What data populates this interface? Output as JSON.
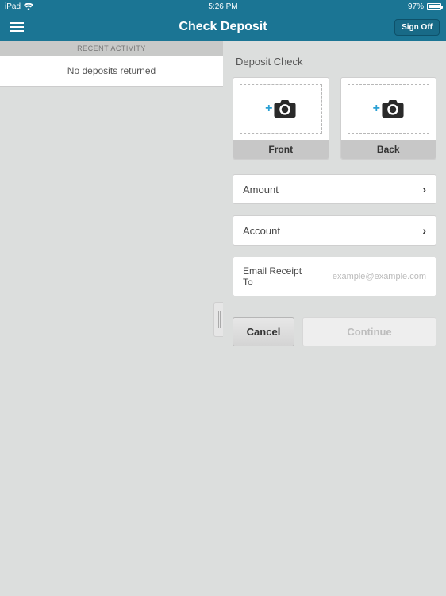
{
  "status": {
    "device": "iPad",
    "time": "5:26 PM",
    "battery_pct": "97%"
  },
  "nav": {
    "title": "Check Deposit",
    "signoff": "Sign Off"
  },
  "recent": {
    "header": "RECENT ACTIVITY",
    "empty": "No deposits returned"
  },
  "deposit": {
    "title": "Deposit Check",
    "front_label": "Front",
    "back_label": "Back",
    "amount_label": "Amount",
    "account_label": "Account",
    "email_label": "Email Receipt To",
    "email_placeholder": "example@example.com",
    "cancel": "Cancel",
    "continue": "Continue"
  }
}
